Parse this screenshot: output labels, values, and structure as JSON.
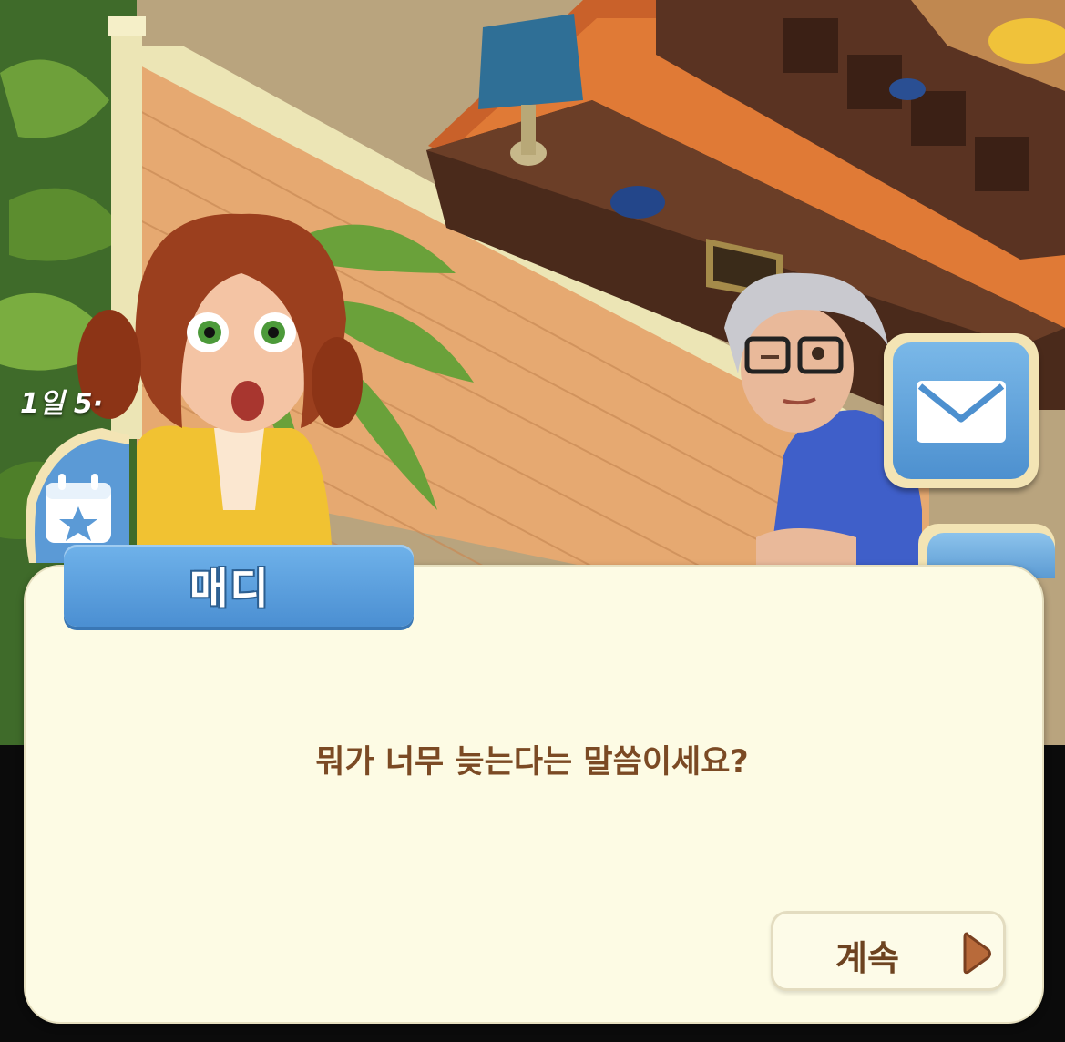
{
  "hud": {
    "date_label": "1일 5·",
    "calendar_icon": "calendar-star-icon",
    "mail_icon": "envelope-icon"
  },
  "dialog": {
    "speaker": "매디",
    "text": "뭐가 너무 늦는다는 말씀이세요?",
    "continue_label": "계속",
    "continue_icon": "play-arrow-icon"
  },
  "colors": {
    "dialog_bg": "#fdfbe4",
    "dialog_text": "#7b4a24",
    "name_tag": "#5a9fdf",
    "mail_button": "#5b9ad6"
  }
}
